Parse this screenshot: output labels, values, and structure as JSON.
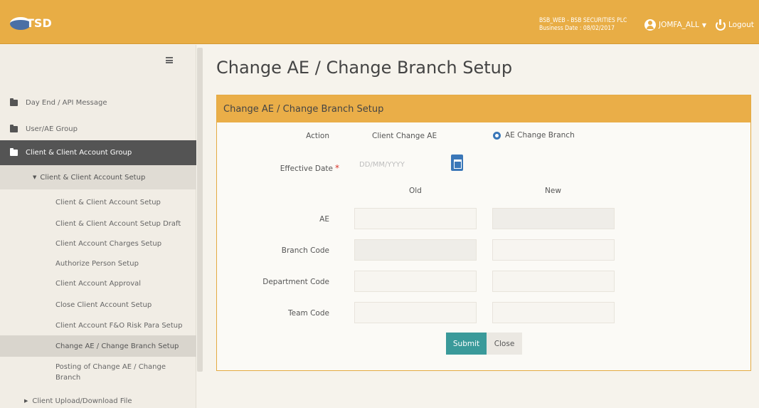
{
  "header": {
    "logo_text": "TSD",
    "company_line": "BSB_WEB - BSB SECURITIES PLC",
    "business_date": "Business Date : 08/02/2017",
    "username": "JOMFA_ALL",
    "logout_label": "Logout"
  },
  "sidebar": {
    "items": [
      {
        "label": "Day End / API Message"
      },
      {
        "label": "User/AE Group"
      },
      {
        "label": "Client & Client Account Group"
      }
    ],
    "submenu_label": "Client & Client Account Setup",
    "leaves": [
      {
        "label": "Client & Client Account Setup"
      },
      {
        "label": "Client & Client Account Setup Draft"
      },
      {
        "label": "Client Account Charges Setup"
      },
      {
        "label": "Authorize Person Setup"
      },
      {
        "label": "Client Account Approval"
      },
      {
        "label": "Close Client Account Setup"
      },
      {
        "label": "Client Account F&O Risk Para Setup"
      },
      {
        "label": "Change AE / Change Branch Setup"
      },
      {
        "label": "Posting of Change AE / Change Branch"
      }
    ],
    "bottom_item": "Client Upload/Download File"
  },
  "main": {
    "page_title": "Change AE / Change Branch Setup",
    "panel_title": "Change AE / Change Branch Setup",
    "form": {
      "action_label": "Action",
      "action_option_1": "Client Change AE",
      "action_option_2": "AE Change Branch",
      "effective_date_label": "Effective Date",
      "required_mark": "*",
      "effective_date_placeholder": "DD/MM/YYYY",
      "old_header": "Old",
      "new_header": "New",
      "ae_label": "AE",
      "branch_code_label": "Branch Code",
      "department_code_label": "Department Code",
      "team_code_label": "Team Code"
    },
    "buttons": {
      "submit": "Submit",
      "close": "Close"
    }
  },
  "colors": {
    "header_bg": "#e8ad45",
    "accent_blue": "#3a77b8",
    "submit_bg": "#3a9a9a"
  }
}
